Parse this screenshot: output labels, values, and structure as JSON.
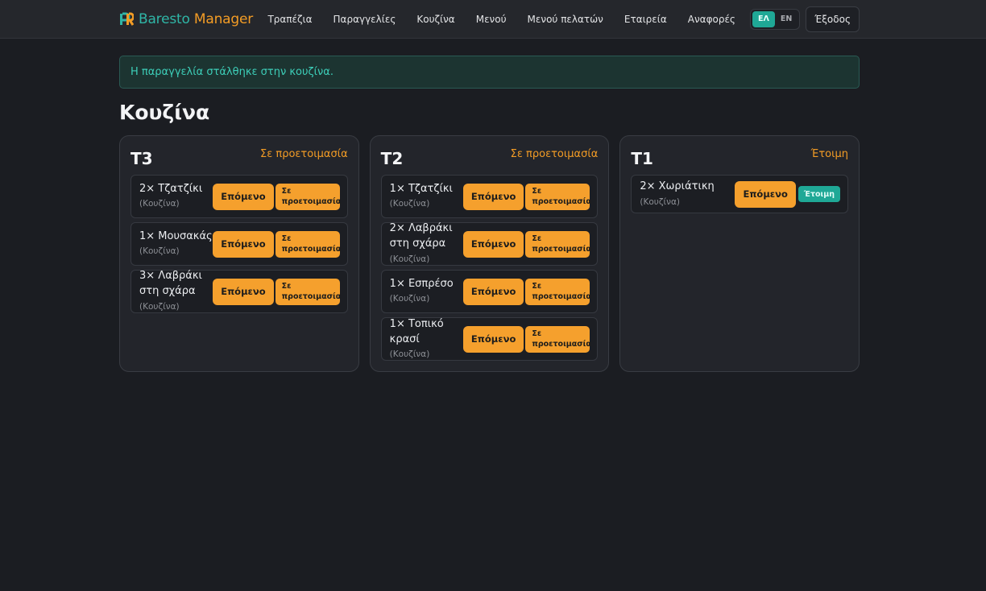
{
  "brand": {
    "part1": "Baresto",
    "part2": "Manager"
  },
  "nav": [
    "Τραπέζια",
    "Παραγγελίες",
    "Κουζίνα",
    "Μενού",
    "Μενού πελατών",
    "Εταιρεία",
    "Αναφορές"
  ],
  "lang": {
    "el": "ΕΛ",
    "en": "EN",
    "active": "el"
  },
  "logout_label": "Έξοδος",
  "alert_text": "Η παραγγελία στάλθηκε στην κουζίνα.",
  "page_title": "Κουζίνα",
  "next_label": "Επόμενο",
  "colors": {
    "accent_orange": "#f5a02d",
    "accent_teal": "#1fa896",
    "background": "#1b1d22"
  },
  "tables": [
    {
      "name": "T3",
      "status": "Σε προετοιμασία",
      "items": [
        {
          "qty_name": "2× Τζατζίκι",
          "station": "(Κουζίνα)",
          "state": "Σε προετοιμασία"
        },
        {
          "qty_name": "1× Μουσακάς",
          "station": "(Κουζίνα)",
          "state": "Σε προετοιμασία"
        },
        {
          "qty_name": "3× Λαβράκι στη σχάρα",
          "station": "(Κουζίνα)",
          "state": "Σε προετοιμασία"
        }
      ]
    },
    {
      "name": "T2",
      "status": "Σε προετοιμασία",
      "items": [
        {
          "qty_name": "1× Τζατζίκι",
          "station": "(Κουζίνα)",
          "state": "Σε προετοιμασία"
        },
        {
          "qty_name": "2× Λαβράκι στη σχάρα",
          "station": "(Κουζίνα)",
          "state": "Σε προετοιμασία"
        },
        {
          "qty_name": "1× Εσπρέσο",
          "station": "(Κουζίνα)",
          "state": "Σε προετοιμασία"
        },
        {
          "qty_name": "1× Τοπικό κρασί",
          "station": "(Κουζίνα)",
          "state": "Σε προετοιμασία"
        }
      ]
    },
    {
      "name": "T1",
      "status": "Έτοιμη",
      "items": [
        {
          "qty_name": "2× Χωριάτικη",
          "station": "(Κουζίνα)",
          "state": "Έτοιμη"
        }
      ]
    }
  ]
}
